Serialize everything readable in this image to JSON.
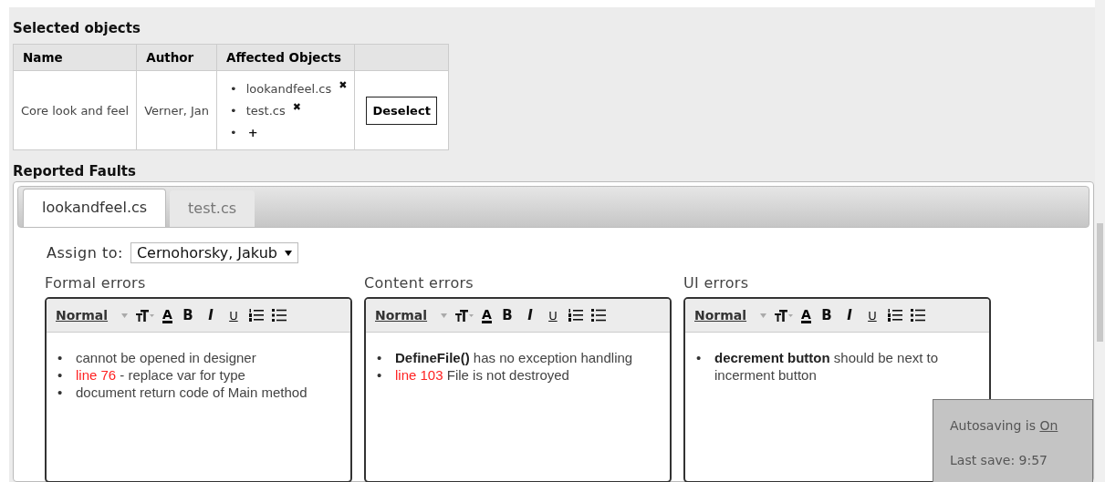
{
  "selected_objects": {
    "title": "Selected objects",
    "columns": [
      "Name",
      "Author",
      "Affected Objects"
    ],
    "rows": [
      {
        "name": "Core look and feel",
        "author": "Verner, Jan",
        "affected": [
          "lookandfeel.cs",
          "test.cs"
        ],
        "add_label": "+",
        "bullet": "•",
        "remove_label": "✖",
        "action": "Deselect"
      }
    ]
  },
  "reported_faults": {
    "title": "Reported Faults",
    "tabs": [
      {
        "label": "lookandfeel.cs",
        "selected": true
      },
      {
        "label": "test.cs",
        "selected": false
      }
    ],
    "assign_label": "Assign to:",
    "bullet": "•",
    "assignee": "Cernohorsky, Jakub",
    "editors": [
      {
        "label": "Formal errors",
        "format": "Normal",
        "bold": "B",
        "italic": "I",
        "underline": "U",
        "color_letter": "A",
        "items": [
          [
            {
              "kind": "plain",
              "text": "cannot be opened in designer"
            }
          ],
          [
            {
              "kind": "red",
              "text": "line 76"
            },
            {
              "kind": "plain",
              "text": " - replace var for type"
            }
          ],
          [
            {
              "kind": "plain",
              "text": "document return code of Main method"
            }
          ]
        ]
      },
      {
        "label": "Content errors",
        "format": "Normal",
        "bold": "B",
        "italic": "I",
        "underline": "U",
        "color_letter": "A",
        "items": [
          [
            {
              "kind": "bold",
              "text": "DefineFile()"
            },
            {
              "kind": "plain",
              "text": " has no exception handling"
            }
          ],
          [
            {
              "kind": "red",
              "text": "line 103"
            },
            {
              "kind": "plain",
              "text": " File is not destroyed"
            }
          ]
        ]
      },
      {
        "label": "UI errors",
        "format": "Normal",
        "bold": "B",
        "italic": "I",
        "underline": "U",
        "color_letter": "A",
        "items": [
          [
            {
              "kind": "bold",
              "text": "decrement button"
            },
            {
              "kind": "plain",
              "text": " should be next to incerment button"
            }
          ]
        ]
      }
    ]
  },
  "autosave": {
    "label": "Autosaving is",
    "state": "On",
    "last_save": "Last save: 9:57"
  }
}
